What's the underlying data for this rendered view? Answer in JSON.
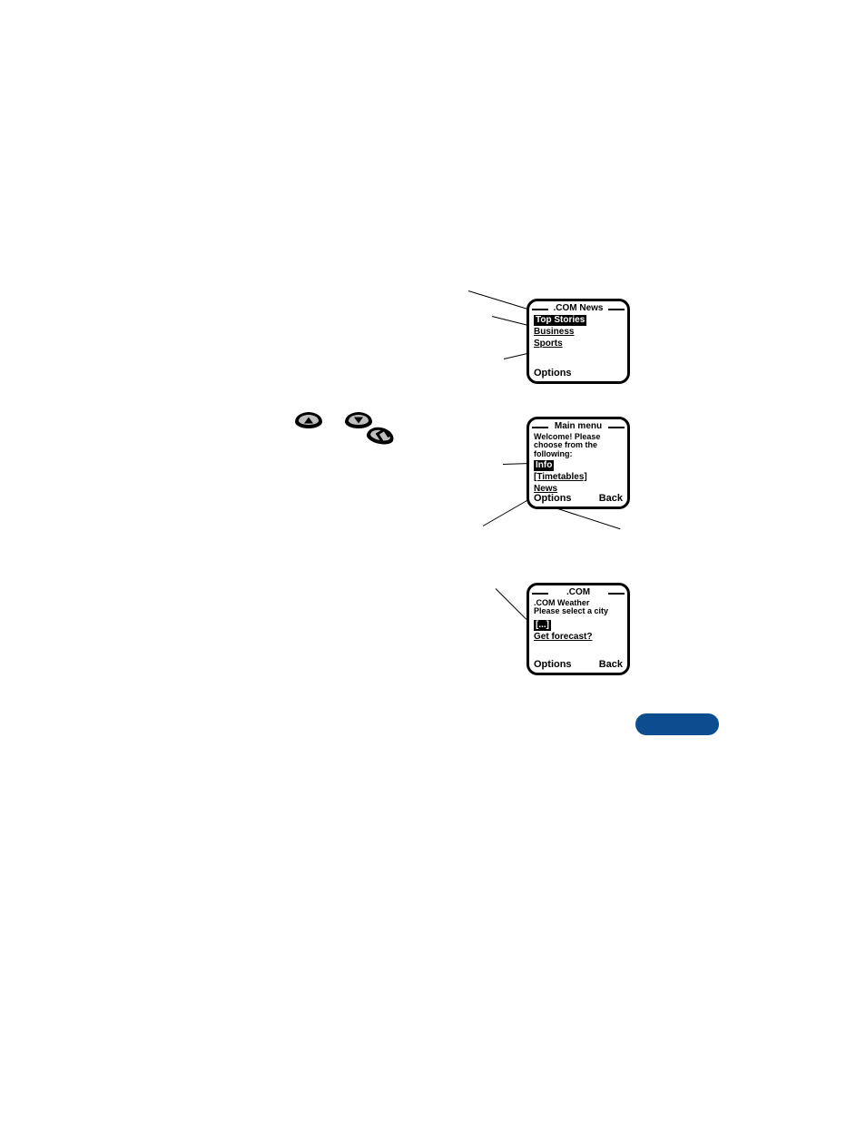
{
  "screen1": {
    "title": ".COM News",
    "selected": "Top Stories",
    "link1": "Business",
    "link2": "Sports",
    "options": "Options"
  },
  "screen2": {
    "title": "Main menu",
    "welcome": "Welcome! Please choose from the following:",
    "selected": "Info",
    "link1": "[Timetables]",
    "link2": "News",
    "options": "Options",
    "back": "Back"
  },
  "screen3": {
    "title": ".COM",
    "line1": ".COM Weather",
    "line2": "Please select a city",
    "selected": "[...]",
    "link1": "Get forecast?",
    "options": "Options",
    "back": "Back"
  }
}
